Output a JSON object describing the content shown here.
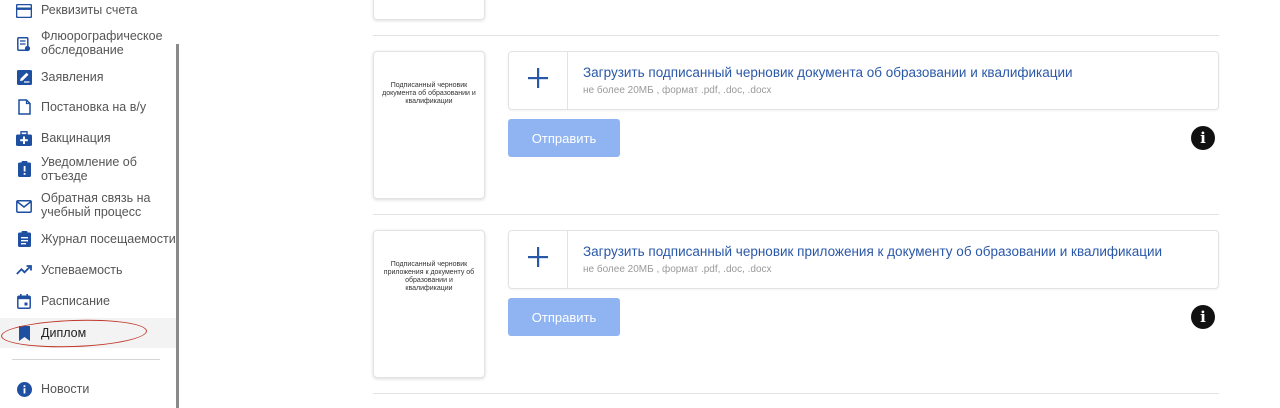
{
  "sidebar": {
    "items": [
      {
        "label": "Реквизиты счета",
        "icon": "credit-card-icon"
      },
      {
        "label": "Флюорографическое обследование",
        "icon": "medical-report-icon"
      },
      {
        "label": "Заявления",
        "icon": "edit-document-icon"
      },
      {
        "label": "Постановка на в/у",
        "icon": "document-icon"
      },
      {
        "label": "Вакцинация",
        "icon": "medical-kit-icon"
      },
      {
        "label": "Уведомление об отъезде",
        "icon": "alert-clipboard-icon"
      },
      {
        "label": "Обратная связь на учебный процесс",
        "icon": "mail-icon"
      },
      {
        "label": "Журнал посещаемости",
        "icon": "clipboard-list-icon"
      },
      {
        "label": "Успеваемость",
        "icon": "trending-up-icon"
      },
      {
        "label": "Расписание",
        "icon": "calendar-icon"
      },
      {
        "label": "Диплом",
        "icon": "bookmark-icon"
      },
      {
        "label": "Новости",
        "icon": "info-circle-icon"
      }
    ],
    "active_item": "Диплом"
  },
  "uploads": [
    {
      "thumbnail_text": "Подписанный черновик документа об образовании и квалификации",
      "title": "Загрузить подписанный черновик документа об образовании и квалификации",
      "hint": "не более 20МБ , формат .pdf, .doc, .docx",
      "send_label": "Отправить",
      "info_glyph": "i"
    },
    {
      "thumbnail_text": "Подписанный черновик приложения к документу об образовании и квалификации",
      "title": "Загрузить подписанный черновик приложения к документу об образовании и квалификации",
      "hint": "не более 20МБ , формат .pdf, .doc, .docx",
      "send_label": "Отправить",
      "info_glyph": "i"
    }
  ],
  "colors": {
    "accent": "#2a58a8",
    "sidebar_icon": "#1f4fa0",
    "button_disabled": "#8fb4f1",
    "annotation": "#c0392b"
  }
}
